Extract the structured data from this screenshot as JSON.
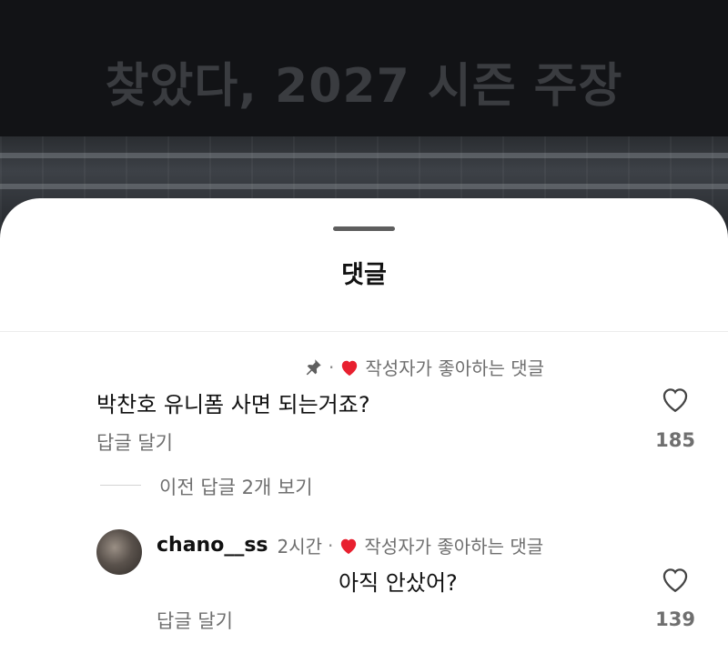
{
  "video": {
    "title": "찾았다, 2027 시즌 주장"
  },
  "sheet": {
    "title": "댓글"
  },
  "comments": [
    {
      "pinned": true,
      "badge": "작성자가 좋아하는 댓글",
      "text": "박찬호 유니폼 사면 되는거죠?",
      "reply_label": "답글 달기",
      "likes": "185"
    },
    {
      "username": "chano__ss",
      "time": "2시간",
      "badge": "작성자가 좋아하는 댓글",
      "text": "아직 안샀어?",
      "reply_label": "답글 달기",
      "likes": "139"
    }
  ],
  "view_previous": "이전 답글 2개 보기",
  "meta_separator": "·",
  "colors": {
    "heart": "#e8202f",
    "secondary_text": "#6f6f6f",
    "sheet_bg": "#ffffff",
    "video_bg": "#0f1012"
  },
  "icons": {
    "pin": "pin-icon",
    "liked_by_creator": "heart-filled-icon",
    "like": "heart-outline-icon"
  }
}
